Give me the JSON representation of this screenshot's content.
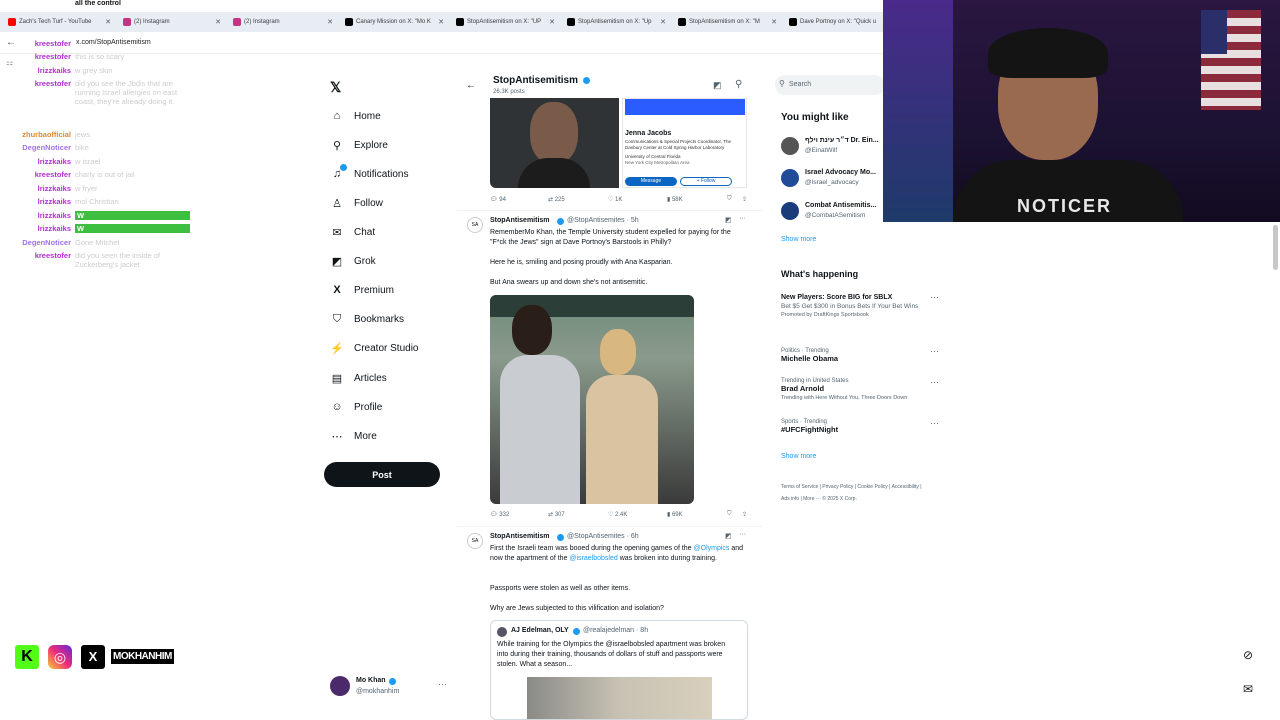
{
  "browser": {
    "tabs": [
      {
        "label": "Zach's Tech Turf - YouTube",
        "icon": "youtube-icon",
        "color": "#ff0000"
      },
      {
        "label": "(2) Instagram",
        "icon": "instagram-icon",
        "color": "#c13584"
      },
      {
        "label": "(2) Instagram",
        "icon": "instagram-icon",
        "color": "#c13584"
      },
      {
        "label": "Canary Mission on X: \"Mo K",
        "icon": "x-icon",
        "color": "#000000"
      },
      {
        "label": "StopAntisemitism on X: \"UP",
        "icon": "x-icon",
        "color": "#000000"
      },
      {
        "label": "StopAntisemitism on X: \"Up",
        "icon": "x-icon",
        "color": "#000000"
      },
      {
        "label": "StopAntisemitism on X: \"M",
        "icon": "x-icon",
        "color": "#000000"
      },
      {
        "label": "Dave Portnoy on X: \"Quick u",
        "icon": "x-icon",
        "color": "#000000"
      }
    ],
    "url": "x.com/StopAntisemitism"
  },
  "chat": {
    "top_text": "all the control",
    "messages": [
      {
        "user": "kreestofer",
        "text": "",
        "color": "#b22fd1"
      },
      {
        "user": "kreestofer",
        "text": "this is so scary",
        "color": "#b22fd1"
      },
      {
        "user": "lrizzkaiks",
        "text": "w grey skin",
        "color": "#b22fd1"
      },
      {
        "user": "kreestofer",
        "text": "did you see the Jbdis that are running Israel allergies on east coast, they're already doing it.",
        "color": "#b22fd1"
      },
      {
        "user": "zhurbaofficial",
        "text": "jews",
        "color": "#e08a2e"
      },
      {
        "user": "DegenNoticer",
        "text": "bike",
        "color": "#a074e8"
      },
      {
        "user": "lrizzkaiks",
        "text": "w israel",
        "color": "#b22fd1"
      },
      {
        "user": "kreestofer",
        "text": "charly is out of jail",
        "color": "#b22fd1"
      },
      {
        "user": "lrizzkaiks",
        "text": "w fryer",
        "color": "#b22fd1"
      },
      {
        "user": "lrizzkaiks",
        "text": "mol Christian",
        "color": "#b22fd1"
      },
      {
        "user": "lrizzkaiks",
        "text": "W",
        "color": "#b22fd1"
      },
      {
        "user": "lrizzkaiks",
        "text": "W",
        "color": "#b22fd1"
      },
      {
        "user": "DegenNoticer",
        "text": "Gone Mitchel",
        "color": "#a074e8"
      },
      {
        "user": "kreestofer",
        "text": "did you seen the inside of Zuckerberg's jacket",
        "color": "#b22fd1"
      }
    ]
  },
  "brand_bar": {
    "handle": "MOKHANHIM"
  },
  "nav": {
    "items": [
      {
        "label": "Home",
        "icon": "home-icon",
        "glyph": "⌂"
      },
      {
        "label": "Explore",
        "icon": "search-icon",
        "glyph": "⌕"
      },
      {
        "label": "Notifications",
        "icon": "bell-icon",
        "glyph": "🔔"
      },
      {
        "label": "Follow",
        "icon": "follow-icon",
        "glyph": "♙"
      },
      {
        "label": "Chat",
        "icon": "mail-icon",
        "glyph": "✉"
      },
      {
        "label": "Grok",
        "icon": "grok-icon",
        "glyph": "◩"
      },
      {
        "label": "Premium",
        "icon": "x-icon",
        "glyph": "𝕏"
      },
      {
        "label": "Bookmarks",
        "icon": "bookmark-icon",
        "glyph": "⛉"
      },
      {
        "label": "Creator Studio",
        "icon": "creator-icon",
        "glyph": "⚡"
      },
      {
        "label": "Articles",
        "icon": "articles-icon",
        "glyph": "▤"
      },
      {
        "label": "Profile",
        "icon": "profile-icon",
        "glyph": "☺"
      },
      {
        "label": "More",
        "icon": "more-icon",
        "glyph": "⋯"
      }
    ],
    "post_label": "Post",
    "account": {
      "name": "Mo Khan",
      "handle": "@mokhanhim"
    }
  },
  "profile_header": {
    "name": "StopAntisemitism",
    "posts": "26.3K posts"
  },
  "tweets": [
    {
      "card": {
        "name": "Jenna Jacobs",
        "role": "Communications & Special Projects Coordinator, The Danbury Center at Cold Spring Harbor Laboratory",
        "school": "University of Central Florida",
        "location": "New York City Metropolitan Area",
        "msg": "Message",
        "follow": "+ Follow"
      },
      "stats": {
        "replies": "94",
        "reposts": "225",
        "likes": "1K",
        "views": "58K"
      }
    },
    {
      "author": "StopAntisemitism",
      "handle": "@StopAntisemites · 5h",
      "p1": "RememberMo Khan, the Temple University student expelled for paying for the \"F*ck the Jews\" sign at Dave Portnoy's Barstools in Philly?",
      "p2": "Here he is, smiling and posing proudly with Ana Kasparian.",
      "p3": "But Ana swears up and down she's not antisemitic.",
      "stats": {
        "replies": "332",
        "reposts": "307",
        "likes": "2.4K",
        "views": "69K"
      }
    },
    {
      "author": "StopAntisemitism",
      "handle": "@StopAntisemites · 6h",
      "p1a": "First the Israeli team was booed during the opening games of the",
      "p1b": "@Olympics",
      "p1c": " and now the apartment of the ",
      "p1d": "@israelbobsled",
      "p1e": " was broken into during training.",
      "p2": "Passports were stolen as well as other items.",
      "p3": "Why are Jews subjected to this vilification and isolation?",
      "quote": {
        "author": "AJ Edelman, OLY",
        "handle": "@realajedelman · 8h",
        "text": "While training for the Olympics the @israelbobsled apartment was broken into during their training, thousands of dollars of stuff and passports were stolen. What a season..."
      }
    }
  ],
  "right": {
    "search_placeholder": "Search",
    "might_like_title": "You might like",
    "suggestions": [
      {
        "name": "ד״ר עינת וילף Dr. Ein...",
        "handle": "@EinatWilf"
      },
      {
        "name": "Israel Advocacy Mo...",
        "handle": "@Israel_advocacy"
      },
      {
        "name": "Combat Antisemitis...",
        "handle": "@CombatASemitism"
      }
    ],
    "show_more": "Show more",
    "happening_title": "What's happening",
    "ad": {
      "title": "New Players: Score BIG for SBLX",
      "body": "Bet $5 Get $300 in Bonus Bets If Your Bet Wins",
      "promo": "Promoted by DraftKings Sportsbook"
    },
    "trends": [
      {
        "cat": "Politics · Trending",
        "name": "Michelle Obama",
        "extra": ""
      },
      {
        "cat": "Trending in United States",
        "name": "Brad Arnold",
        "extra": "Trending with Here Without You, Three Doors Down"
      },
      {
        "cat": "Sports · Trending",
        "name": "#UFCFightNight",
        "extra": ""
      }
    ],
    "footer": "Terms of Service | Privacy Policy | Cookie Policy | Accessibility | Ads info | More ··· © 2025 X Corp."
  },
  "webcam": {
    "shirt_text": "NOTICER"
  }
}
